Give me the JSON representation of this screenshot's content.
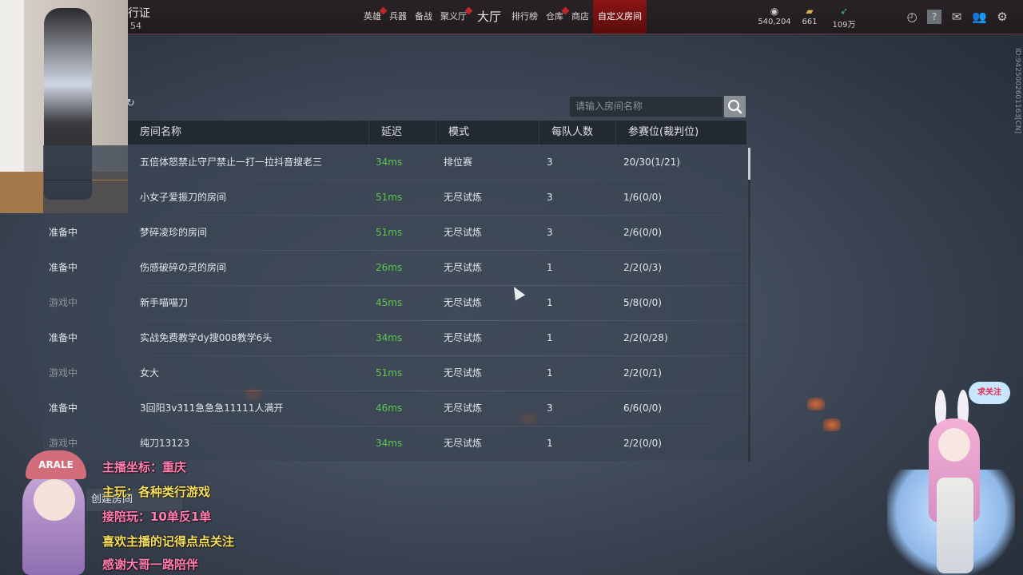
{
  "topbar": {
    "title": "行证",
    "level": "54",
    "nav": [
      {
        "label": "英雄",
        "dot": true
      },
      {
        "label": "兵器",
        "dot": false
      },
      {
        "label": "备战",
        "dot": false
      },
      {
        "label": "聚义厅",
        "dot": true
      },
      {
        "label": "大厅",
        "dot": false
      },
      {
        "label": "排行榜",
        "dot": false
      },
      {
        "label": "仓库",
        "dot": true
      },
      {
        "label": "商店",
        "dot": false
      },
      {
        "label": "自定义房间",
        "dot": false,
        "active": true
      }
    ],
    "resources": [
      {
        "icon": "coin-stack-icon",
        "value": "540,204"
      },
      {
        "icon": "gold-bar-icon",
        "value": "661"
      },
      {
        "icon": "feather-icon",
        "value": "109万"
      }
    ],
    "tools": [
      "timer-icon",
      "help-icon",
      "mail-icon",
      "friends-icon",
      "settings-icon"
    ],
    "side_id": "ID:9425002601163[CN]"
  },
  "search": {
    "placeholder": "请输入房间名称"
  },
  "table": {
    "headers": [
      "房间名称",
      "延迟",
      "模式",
      "每队人数",
      "参赛位(裁判位)"
    ],
    "rows": [
      {
        "status": "",
        "name": "五倍体怒禁止守尸禁止一打一拉抖音搜老三",
        "latency": "34ms",
        "mode": "排位赛",
        "per_team": "3",
        "slots": "20/30(1/21)"
      },
      {
        "status": "",
        "name": "小女子爱振刀的房间",
        "latency": "51ms",
        "mode": "无尽试炼",
        "per_team": "3",
        "slots": "1/6(0/0)"
      },
      {
        "status": "准备中",
        "name": "梦碎凌珍的房间",
        "latency": "51ms",
        "mode": "无尽试炼",
        "per_team": "3",
        "slots": "2/6(0/0)"
      },
      {
        "status": "准备中",
        "name": "伤感破碎の灵的房间",
        "latency": "26ms",
        "mode": "无尽试炼",
        "per_team": "1",
        "slots": "2/2(0/3)"
      },
      {
        "status": "游戏中",
        "name": "新手喵喵刀",
        "latency": "45ms",
        "mode": "无尽试炼",
        "per_team": "1",
        "slots": "5/8(0/0)"
      },
      {
        "status": "准备中",
        "name": "实战免费教学dy搜008教学6头",
        "latency": "34ms",
        "mode": "无尽试炼",
        "per_team": "1",
        "slots": "2/2(0/28)"
      },
      {
        "status": "游戏中",
        "name": "女大",
        "latency": "51ms",
        "mode": "无尽试炼",
        "per_team": "1",
        "slots": "2/2(0/1)"
      },
      {
        "status": "准备中",
        "name": "3回阳3v311急急急11111人满开",
        "latency": "46ms",
        "mode": "无尽试炼",
        "per_team": "3",
        "slots": "6/6(0/0)"
      },
      {
        "status": "游戏中",
        "name": "纯刀13123",
        "latency": "34ms",
        "mode": "无尽试炼",
        "per_team": "1",
        "slots": "2/2(0/0)"
      }
    ]
  },
  "create_room_label": "创建房间",
  "overlay": {
    "cap_text": "ARALE",
    "lines": [
      {
        "text": "主播坐标：重庆",
        "color": "pink"
      },
      {
        "text": "主玩：各种类行游戏",
        "color": "yellow"
      },
      {
        "text": "接陪玩：10单反1单",
        "color": "pink"
      },
      {
        "text": "喜欢主播的记得点点关注",
        "color": "yellow"
      },
      {
        "text": "感谢大哥一路陪伴",
        "color": "pink"
      }
    ],
    "bubble": "求关注"
  }
}
